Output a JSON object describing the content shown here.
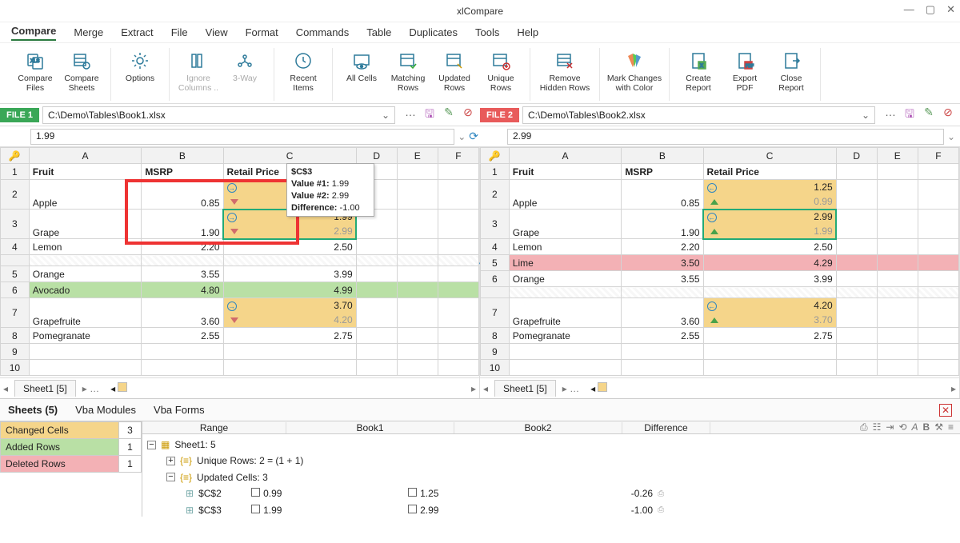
{
  "app": {
    "title": "xlCompare"
  },
  "menu": [
    "Compare",
    "Merge",
    "Extract",
    "File",
    "View",
    "Format",
    "Commands",
    "Table",
    "Duplicates",
    "Tools",
    "Help"
  ],
  "ribbon": [
    {
      "label": "Compare\nFiles",
      "icon": "xls-compare"
    },
    {
      "label": "Compare\nSheets",
      "icon": "sheet-compare"
    },
    {
      "label": "Options",
      "icon": "gear"
    },
    {
      "label": "Ignore\nColumns ..",
      "icon": "columns",
      "disabled": true
    },
    {
      "label": "3-Way",
      "icon": "3way",
      "disabled": true
    },
    {
      "label": "Recent\nItems",
      "icon": "clock"
    },
    {
      "label": "All Cells",
      "icon": "eye"
    },
    {
      "label": "Matching\nRows",
      "icon": "table-check"
    },
    {
      "label": "Updated\nRows",
      "icon": "table-edit"
    },
    {
      "label": "Unique\nRows",
      "icon": "table-plus"
    },
    {
      "label": "Remove\nHidden Rows",
      "icon": "remove-rows",
      "wide": true
    },
    {
      "label": "Mark Changes\nwith Color",
      "icon": "palette",
      "wide": true
    },
    {
      "label": "Create\nReport",
      "icon": "report-xls"
    },
    {
      "label": "Export\nPDF",
      "icon": "report-pdf"
    },
    {
      "label": "Close\nReport",
      "icon": "close-report"
    }
  ],
  "file1": {
    "chip": "FILE 1",
    "path": "C:\\Demo\\Tables\\Book1.xlsx",
    "formula": "1.99"
  },
  "file2": {
    "chip": "FILE 2",
    "path": "C:\\Demo\\Tables\\Book2.xlsx",
    "formula": "2.99"
  },
  "cols": [
    "A",
    "B",
    "C",
    "D",
    "E",
    "F"
  ],
  "hdr": {
    "fruit": "Fruit",
    "msrp": "MSRP",
    "retail": "Retail Price"
  },
  "left": {
    "rows": [
      {
        "n": "2",
        "a": "Apple",
        "b": "0.85",
        "c_top": "0.99",
        "c_bot": "1.25",
        "ghost": "bot",
        "ch": true
      },
      {
        "n": "3",
        "a": "Grape",
        "b": "1.90",
        "c_top": "1.99",
        "c_bot": "2.99",
        "ghost": "bot",
        "ch": true,
        "sel": true
      },
      {
        "n": "4",
        "a": "Lemon",
        "b": "2.20",
        "c": "2.50"
      },
      {
        "n": "5",
        "a": "Orange",
        "b": "3.55",
        "c": "3.99"
      },
      {
        "n": "6",
        "a": "Avocado",
        "b": "4.80",
        "c": "4.99",
        "added": true
      },
      {
        "n": "7",
        "a": "Grapefruite",
        "b": "3.60",
        "c_top": "3.70",
        "c_bot": "4.20",
        "ghost": "bot",
        "ch": true
      },
      {
        "n": "8",
        "a": "Pomegranate",
        "b": "2.55",
        "c": "2.75"
      },
      {
        "n": "9",
        "a": "",
        "b": "",
        "c": ""
      },
      {
        "n": "10",
        "a": "",
        "b": "",
        "c": ""
      }
    ]
  },
  "right": {
    "rows": [
      {
        "n": "2",
        "a": "Apple",
        "b": "0.85",
        "c_top": "1.25",
        "c_bot": "0.99",
        "ghost": "bot",
        "ch": true
      },
      {
        "n": "3",
        "a": "Grape",
        "b": "1.90",
        "c_top": "2.99",
        "c_bot": "1.99",
        "ghost": "bot",
        "ch": true,
        "sel": true
      },
      {
        "n": "4",
        "a": "Lemon",
        "b": "2.20",
        "c": "2.50"
      },
      {
        "n": "5",
        "a": "Lime",
        "b": "3.50",
        "c": "4.29",
        "deleted": true
      },
      {
        "n": "6",
        "a": "Orange",
        "b": "3.55",
        "c": "3.99"
      },
      {
        "n": "7",
        "a": "Grapefruite",
        "b": "3.60",
        "c_top": "4.20",
        "c_bot": "3.70",
        "ghost": "bot",
        "ch": true
      },
      {
        "n": "8",
        "a": "Pomegranate",
        "b": "2.55",
        "c": "2.75"
      },
      {
        "n": "9",
        "a": "",
        "b": "",
        "c": ""
      },
      {
        "n": "10",
        "a": "",
        "b": "",
        "c": ""
      }
    ]
  },
  "tooltip": {
    "ref": "$C$3",
    "v1l": "Value #1:",
    "v1": "1.99",
    "v2l": "Value #2:",
    "v2": "2.99",
    "dl": "Difference:",
    "d": "-1.00"
  },
  "sheetTab": "Sheet1 [5]",
  "bottomTabs": [
    "Sheets (5)",
    "Vba Modules",
    "Vba Forms"
  ],
  "legend": [
    {
      "label": "Changed Cells",
      "count": "3",
      "cls": "changed"
    },
    {
      "label": "Added Rows",
      "count": "1",
      "cls": "added"
    },
    {
      "label": "Deleted Rows",
      "count": "1",
      "cls": "deleted"
    }
  ],
  "detailHdr": {
    "range": "Range",
    "b1": "Book1",
    "b2": "Book2",
    "diff": "Difference"
  },
  "tree": {
    "root": "Sheet1: 5",
    "unique": "Unique Rows: 2 = (1 + 1)",
    "updated": "Updated Cells: 3",
    "cells": [
      {
        "ref": "$C$2",
        "b1": "0.99",
        "b2": "1.25",
        "diff": "-0.26"
      },
      {
        "ref": "$C$3",
        "b1": "1.99",
        "b2": "2.99",
        "diff": "-1.00"
      }
    ]
  }
}
